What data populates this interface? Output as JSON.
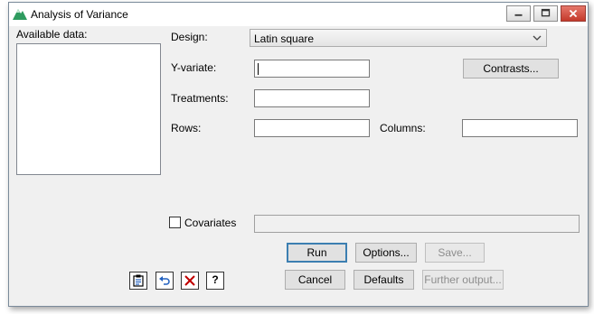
{
  "window": {
    "title": "Analysis of Variance"
  },
  "available_data": {
    "label": "Available data:"
  },
  "design": {
    "label": "Design:",
    "value": "Latin square"
  },
  "y_variate": {
    "label": "Y-variate:",
    "value": ""
  },
  "treatments": {
    "label": "Treatments:",
    "value": ""
  },
  "rows": {
    "label": "Rows:",
    "value": ""
  },
  "columns": {
    "label": "Columns:",
    "value": ""
  },
  "covariates": {
    "label": "Covariates",
    "checked": false,
    "value": ""
  },
  "buttons": {
    "contrasts": "Contrasts...",
    "run": "Run",
    "options": "Options...",
    "save": "Save...",
    "cancel": "Cancel",
    "defaults": "Defaults",
    "further_output": "Further output..."
  },
  "toolbar": {
    "help": "?"
  },
  "icons": {
    "app": "mountain-icon",
    "copy_settings": "clipboard-icon",
    "undo": "undo-arrow-icon",
    "clear": "red-x-icon",
    "help": "help-icon"
  },
  "colors": {
    "default_button_border": "#3c7fb1",
    "close_button": "#c4392b",
    "clear_icon": "#c00000",
    "undo_icon": "#1f5fbf"
  }
}
